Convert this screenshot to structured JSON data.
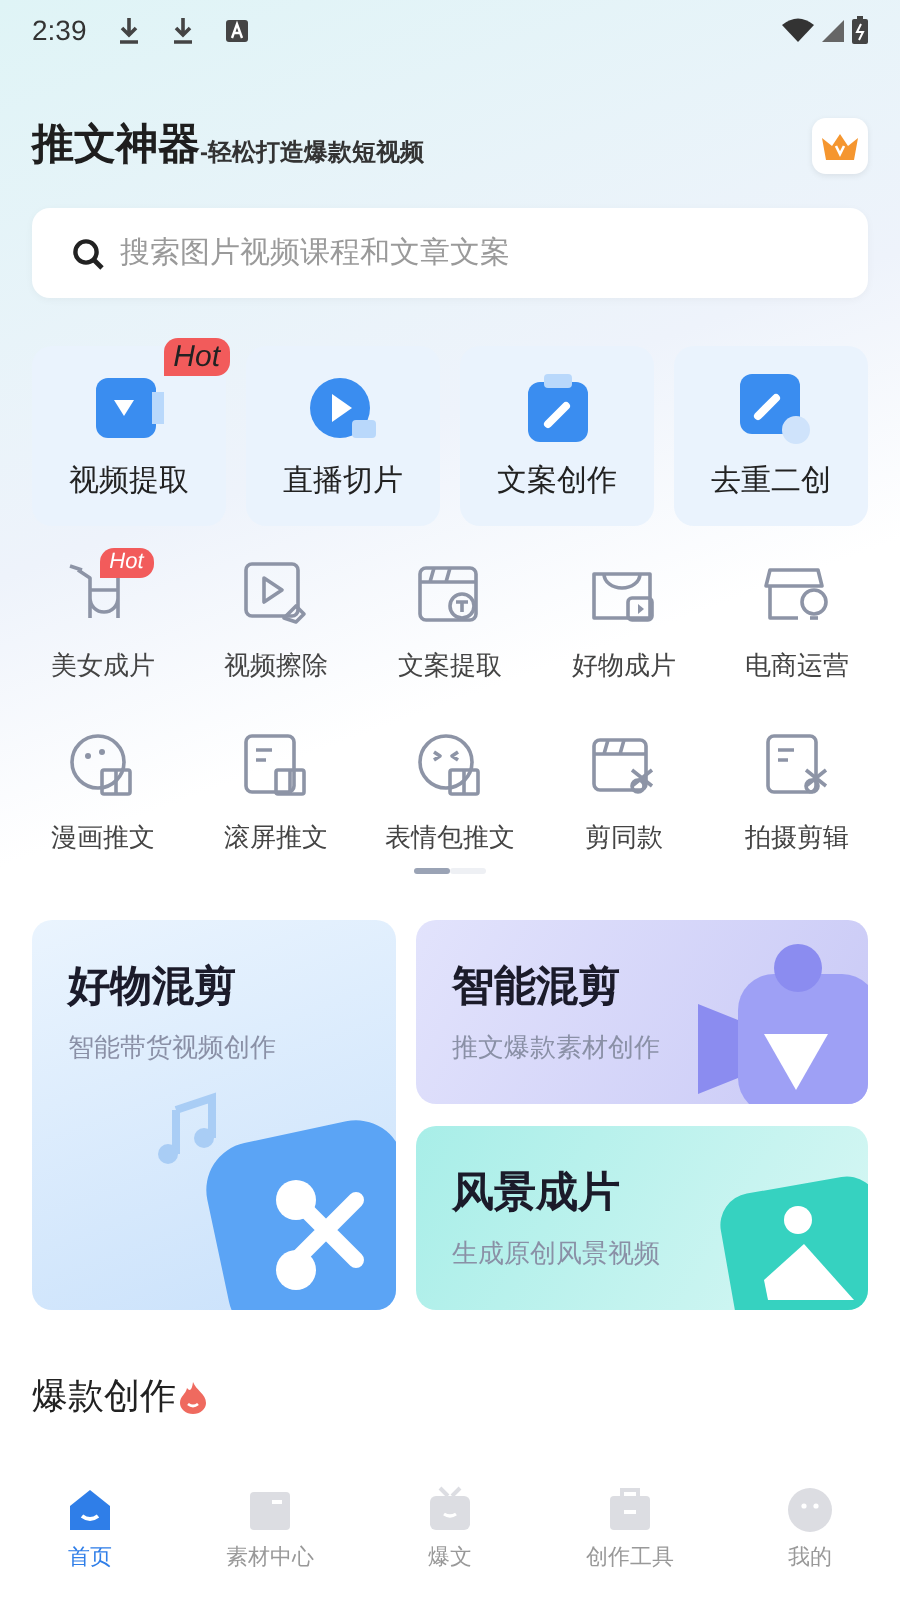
{
  "status_bar": {
    "time": "2:39"
  },
  "header": {
    "title": "推文神器",
    "subtitle": "-轻松打造爆款短视频"
  },
  "search": {
    "placeholder": "搜索图片视频课程和文章文案"
  },
  "main_tools": [
    {
      "label": "视频提取",
      "badge": "Hot"
    },
    {
      "label": "直播切片"
    },
    {
      "label": "文案创作"
    },
    {
      "label": "去重二创"
    }
  ],
  "tools": [
    {
      "label": "美女成片",
      "badge": "Hot"
    },
    {
      "label": "视频擦除"
    },
    {
      "label": "文案提取"
    },
    {
      "label": "好物成片"
    },
    {
      "label": "电商运营"
    },
    {
      "label": "漫画推文"
    },
    {
      "label": "滚屏推文"
    },
    {
      "label": "表情包推文"
    },
    {
      "label": "剪同款"
    },
    {
      "label": "拍摄剪辑"
    }
  ],
  "pager": [
    {
      "selected": true
    },
    {
      "selected": false
    }
  ],
  "feature_cards": [
    {
      "kind": "music",
      "title": "好物混剪",
      "subtitle": "智能带货视频创作"
    },
    {
      "kind": "camera",
      "title": "智能混剪",
      "subtitle": "推文爆款素材创作"
    },
    {
      "kind": "picture",
      "title": "风景成片",
      "subtitle": "生成原创风景视频"
    }
  ],
  "section": {
    "title": "爆款创作"
  },
  "bottom_nav": [
    {
      "label": "首页",
      "selected": true
    },
    {
      "label": "素材中心",
      "selected": false
    },
    {
      "label": "爆文",
      "selected": false
    },
    {
      "label": "创作工具",
      "selected": false
    },
    {
      "label": "我的",
      "selected": false
    }
  ]
}
